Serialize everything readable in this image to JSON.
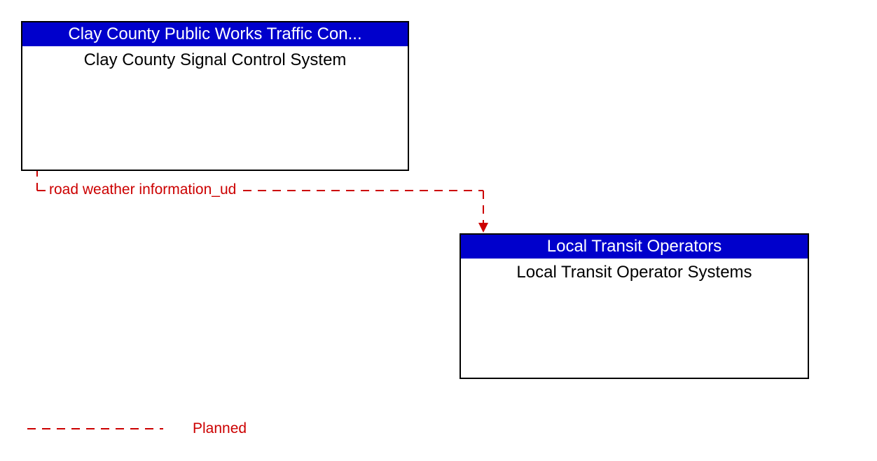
{
  "boxes": {
    "source": {
      "header": "Clay County Public Works Traffic Con...",
      "body": "Clay County Signal Control System"
    },
    "target": {
      "header": "Local Transit Operators",
      "body": "Local Transit Operator Systems"
    }
  },
  "flow": {
    "label": "road weather information_ud"
  },
  "legend": {
    "label": "Planned"
  }
}
